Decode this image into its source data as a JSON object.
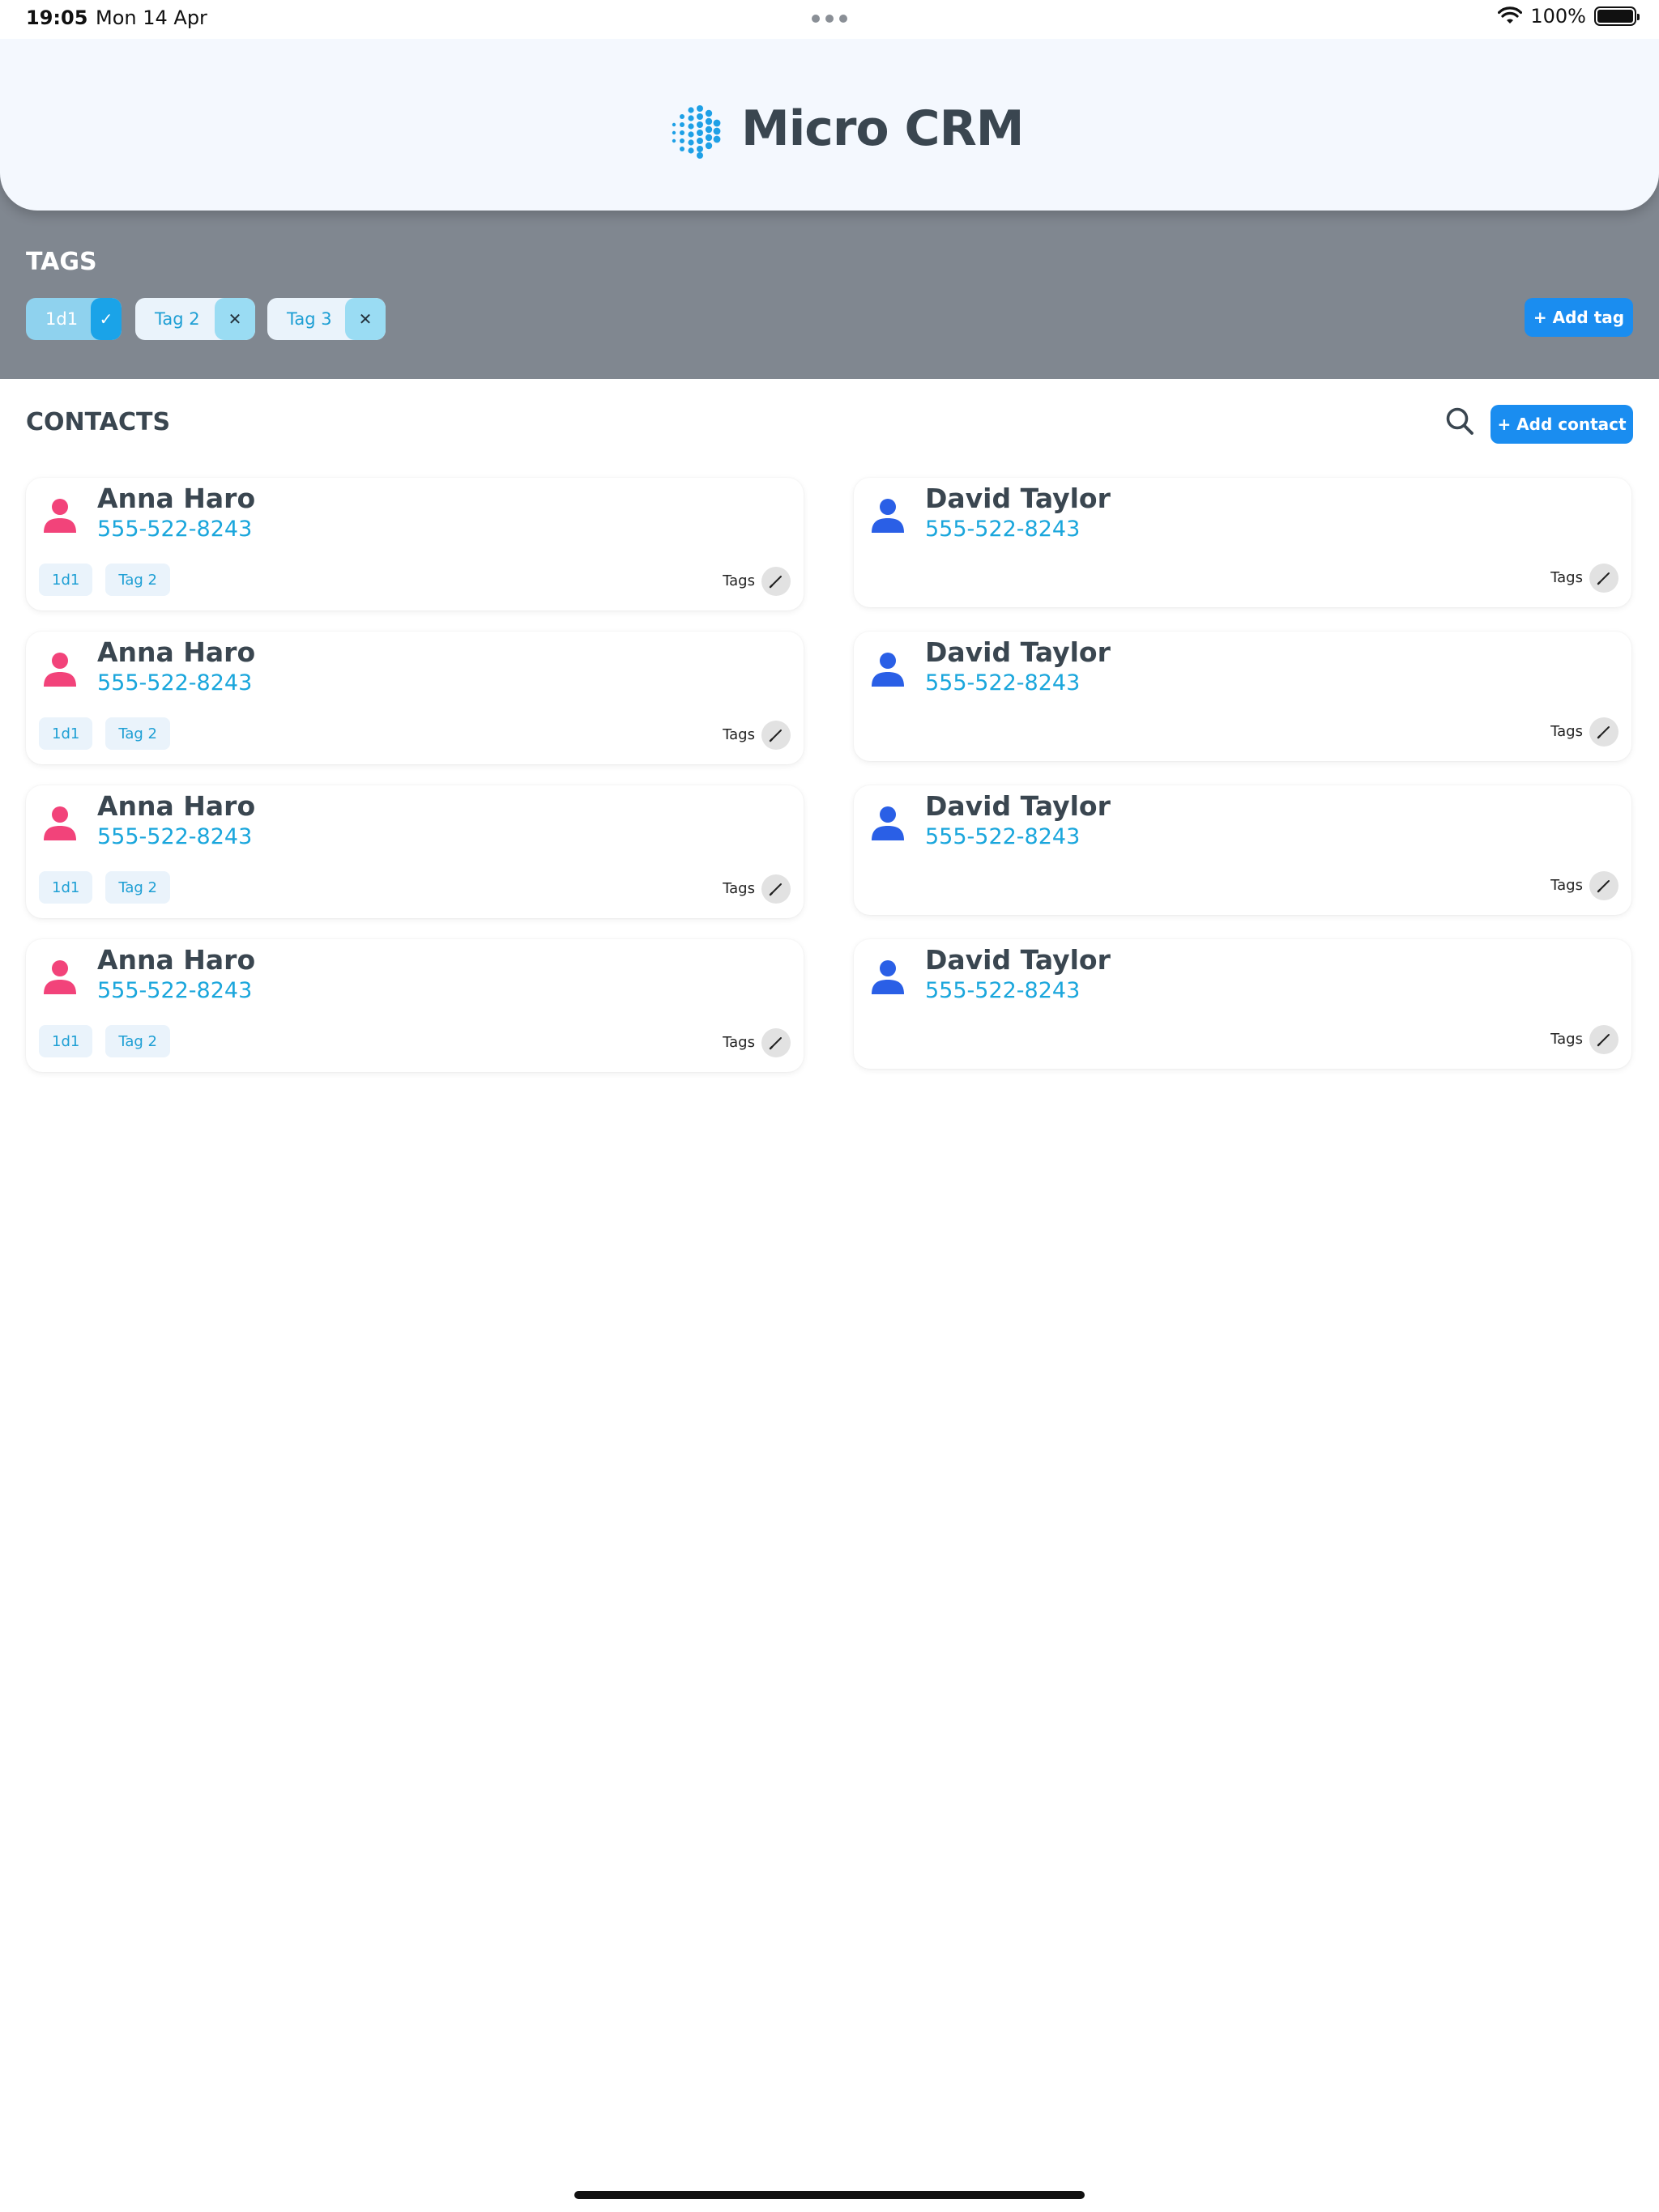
{
  "status_bar": {
    "time": "19:05",
    "date": "Mon 14 Apr",
    "battery": "100%"
  },
  "header": {
    "title": "Micro CRM",
    "logo_icon": "dotted-sphere-icon"
  },
  "tags": {
    "heading": "TAGS",
    "items": [
      {
        "label": "1d1",
        "action": "✓",
        "state": "active"
      },
      {
        "label": "Tag 2",
        "action": "✕",
        "state": "inactive"
      },
      {
        "label": "Tag 3",
        "action": "✕",
        "state": "inactive"
      }
    ],
    "add_label": "+ Add tag"
  },
  "contacts": {
    "heading": "CONTACTS",
    "add_label": "+ Add contact",
    "tags_label": "Tags",
    "left": [
      {
        "name": "Anna Haro",
        "phone": "555-522-8243",
        "tags": [
          "1d1",
          "Tag 2"
        ]
      },
      {
        "name": "Anna Haro",
        "phone": "555-522-8243",
        "tags": [
          "1d1",
          "Tag 2"
        ]
      },
      {
        "name": "Anna Haro",
        "phone": "555-522-8243",
        "tags": [
          "1d1",
          "Tag 2"
        ]
      },
      {
        "name": "Anna Haro",
        "phone": "555-522-8243",
        "tags": [
          "1d1",
          "Tag 2"
        ]
      }
    ],
    "right": [
      {
        "name": "David Taylor",
        "phone": "555-522-8243",
        "tags": []
      },
      {
        "name": "David Taylor",
        "phone": "555-522-8243",
        "tags": []
      },
      {
        "name": "David Taylor",
        "phone": "555-522-8243",
        "tags": []
      },
      {
        "name": "David Taylor",
        "phone": "555-522-8243",
        "tags": []
      }
    ]
  },
  "colors": {
    "accent": "#1a8df0",
    "female_avatar": "#f2437a",
    "male_avatar": "#2a5fe6",
    "tags_bar": "#808790"
  }
}
